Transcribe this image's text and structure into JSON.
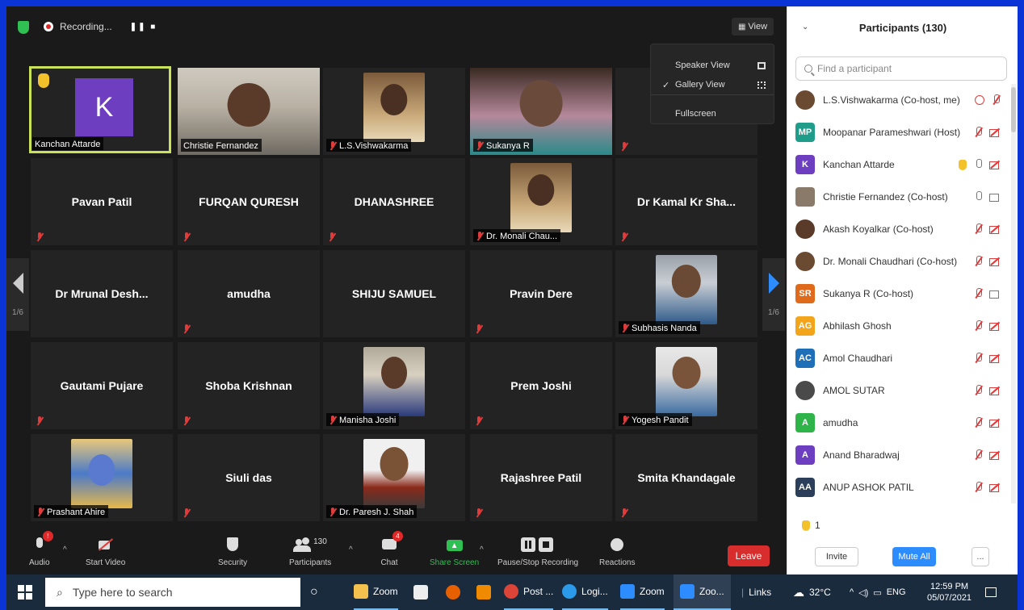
{
  "topbar": {
    "recording_label": "Recording...",
    "view_label": "View"
  },
  "view_menu": {
    "speaker_view": "Speaker View",
    "gallery_view": "Gallery View",
    "fullscreen": "Fullscreen"
  },
  "gallery": {
    "page_left": "1/6",
    "page_right": "1/6",
    "tiles": [
      {
        "label": "Kanchan Attarde",
        "avatar_letter": "K"
      },
      {
        "label": "Christie Fernandez"
      },
      {
        "label": "L.S.Vishwakarma"
      },
      {
        "label": "Sukanya R"
      },
      {
        "label": ""
      },
      {
        "name": "Pavan Patil"
      },
      {
        "name": "FURQAN QURESH"
      },
      {
        "name": "DHANASHREE"
      },
      {
        "label": "Dr. Monali Chau..."
      },
      {
        "name": "Dr Kamal Kr Sha..."
      },
      {
        "name": "Dr Mrunal Desh..."
      },
      {
        "name": "amudha"
      },
      {
        "name": "SHIJU SAMUEL"
      },
      {
        "name": "Pravin Dere"
      },
      {
        "label": "Subhasis Nanda"
      },
      {
        "name": "Gautami Pujare"
      },
      {
        "name": "Shoba Krishnan"
      },
      {
        "label": "Manisha Joshi"
      },
      {
        "name": "Prem Joshi"
      },
      {
        "label": "Yogesh Pandit"
      },
      {
        "label": "Prashant Ahire"
      },
      {
        "name": "Siuli das"
      },
      {
        "label": "Dr. Paresh J. Shah"
      },
      {
        "name": "Rajashree Patil"
      },
      {
        "name": "Smita Khandagale"
      }
    ]
  },
  "toolbar": {
    "audio": "Audio",
    "audio_badge": "!",
    "start_video": "Start Video",
    "security": "Security",
    "participants": "Participants",
    "participants_count": "130",
    "chat": "Chat",
    "chat_badge": "4",
    "share_screen": "Share Screen",
    "pause_stop_recording": "Pause/Stop Recording",
    "reactions": "Reactions",
    "leave": "Leave"
  },
  "panel": {
    "title": "Participants (130)",
    "search_placeholder": "Find a participant",
    "raised_hands": "1",
    "invite": "Invite",
    "mute_all": "Mute All",
    "more": "...",
    "participants": [
      {
        "name": "L.S.Vishwakarma (Co-host, me)",
        "avatar": "photo",
        "color": "#6b4a32"
      },
      {
        "name": "Moopanar Parameshwari (Host)",
        "avatar": "MP",
        "color": "#1f9d8a"
      },
      {
        "name": "Kanchan Attarde",
        "avatar": "K",
        "color": "#6d3fc0"
      },
      {
        "name": "Christie Fernandez (Co-host)",
        "avatar": "photo",
        "color": "#8a7a6a"
      },
      {
        "name": "Akash Koyalkar (Co-host)",
        "avatar": "photo",
        "color": "#5a3b2a"
      },
      {
        "name": "Dr. Monali Chaudhari (Co-host)",
        "avatar": "photo",
        "color": "#6b4a32"
      },
      {
        "name": "Sukanya R (Co-host)",
        "avatar": "SR",
        "color": "#e06a1c"
      },
      {
        "name": "Abhilash Ghosh",
        "avatar": "AG",
        "color": "#f2a51a"
      },
      {
        "name": "Amol Chaudhari",
        "avatar": "AC",
        "color": "#1f6fb8"
      },
      {
        "name": "AMOL SUTAR",
        "avatar": "photo",
        "color": "#4a4a4a"
      },
      {
        "name": "amudha",
        "avatar": "A",
        "color": "#2fb44a"
      },
      {
        "name": "Anand Bharadwaj",
        "avatar": "A",
        "color": "#6d3fc0"
      },
      {
        "name": "ANUP ASHOK PATIL",
        "avatar": "AA",
        "color": "#2b3f5a"
      }
    ]
  },
  "taskbar": {
    "search_placeholder": "Type here to search",
    "apps": [
      "Zoom",
      "Post ...",
      "Logi...",
      "Zoom",
      "Zoo..."
    ],
    "links": "Links",
    "temperature": "32°C",
    "language": "ENG",
    "time": "12:59 PM",
    "date": "05/07/2021"
  },
  "colors": {
    "accent": "#2d8cff",
    "leave": "#d72d2d",
    "active_speaker": "#c9e25a",
    "mute": "#e03b3b"
  }
}
